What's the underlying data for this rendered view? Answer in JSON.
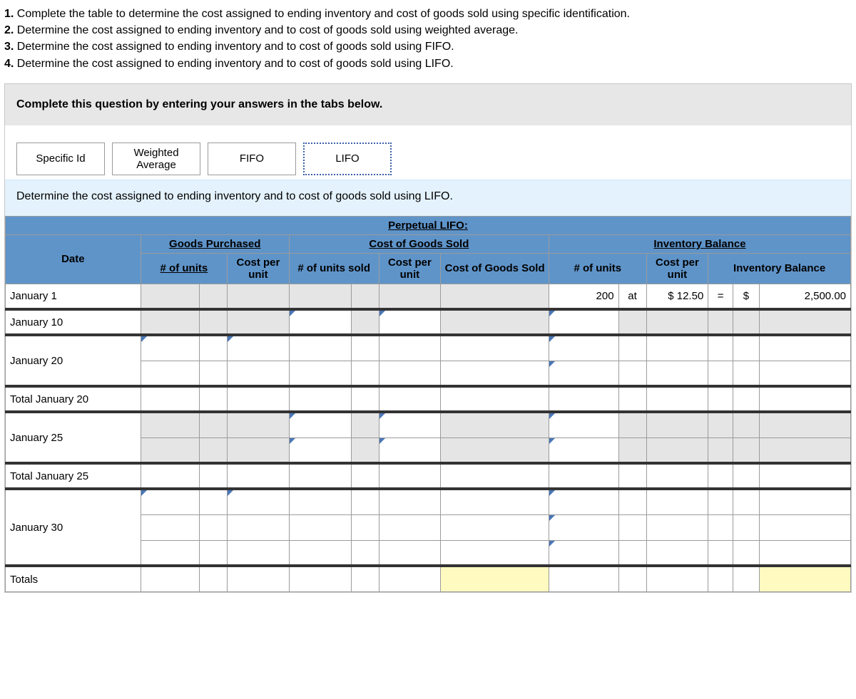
{
  "instructions": {
    "l1": "1. Complete the table to determine the cost assigned to ending inventory and cost of goods sold using specific identification.",
    "l2": "2. Determine the cost assigned to ending inventory and to cost of goods sold using weighted average.",
    "l3": "3. Determine the cost assigned to ending inventory and to cost of goods sold using FIFO.",
    "l4": "4. Determine the cost assigned to ending inventory and to cost of goods sold using LIFO."
  },
  "panel": {
    "header": "Complete this question by entering your answers in the tabs below."
  },
  "tabs": {
    "t1": "Specific Id",
    "t2": "Weighted Average",
    "t3": "FIFO",
    "t4": "LIFO"
  },
  "subprompt": "Determine the cost assigned to ending inventory and to cost of goods sold using LIFO.",
  "headers": {
    "title": "Perpetual LIFO:",
    "date": "Date",
    "gp": "Goods Purchased",
    "cogs": "Cost of Goods Sold",
    "ib": "Inventory Balance",
    "nunits": "# of units",
    "cpu": "Cost per unit",
    "nus": "# of units sold",
    "cogssub": "Cost of Goods Sold",
    "ibsub": "Inventory Balance"
  },
  "rows": {
    "jan1": "January 1",
    "jan10": "January 10",
    "jan20": "January 20",
    "tjan20": "Total January 20",
    "jan25": "January 25",
    "tjan25": "Total January 25",
    "jan30": "January 30",
    "totals": "Totals"
  },
  "jan1": {
    "units": "200",
    "at": "at",
    "cpu": "$ 12.50",
    "eq": "=",
    "cur": "$",
    "bal": "2,500.00"
  }
}
